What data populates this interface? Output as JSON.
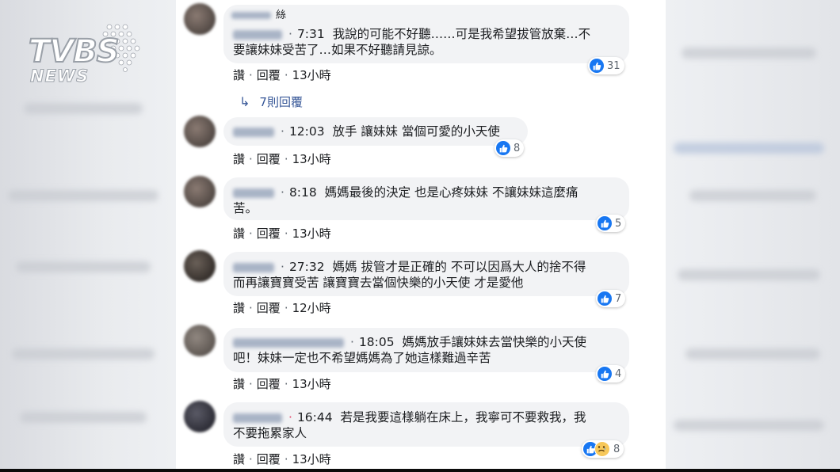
{
  "watermark": {
    "brand": "TVBS",
    "sub": "NEWS"
  },
  "comments": [
    {
      "name_suffix": "絲",
      "time": "7:31",
      "text": "我說的可能不好聽……可是我希望拔管放棄…不",
      "text2": "要讓妹妹受苦了…如果不好聽請見諒。",
      "reactions": "31",
      "like": "讚",
      "reply": "回覆",
      "age": "13小時",
      "replies_label": "7則回覆"
    },
    {
      "time": "12:03",
      "text": "放手 讓妹妹 當個可愛的小天使",
      "reactions": "8",
      "like": "讚",
      "reply": "回覆",
      "age": "13小時"
    },
    {
      "time": "8:18",
      "text": "媽媽最後的決定 也是心疼妹妹 不讓妹妹這麼痛",
      "text2": "苦。",
      "reactions": "5",
      "like": "讚",
      "reply": "回覆",
      "age": "13小時"
    },
    {
      "time": "27:32",
      "text": "媽媽 拔管才是正確的 不可以因爲大人的捨不得",
      "text2": "而再讓寶寶受苦 讓寶寶去當個快樂的小天使 才是愛他",
      "reactions": "7",
      "like": "讚",
      "reply": "回覆",
      "age": "12小時"
    },
    {
      "time": "18:05",
      "text": "媽媽放手讓妹妹去當快樂的小天使",
      "text2": "吧！妹妹一定也不希望媽媽為了她這樣難過辛苦",
      "reactions": "4",
      "like": "讚",
      "reply": "回覆",
      "age": "13小時"
    },
    {
      "time": "16:44",
      "text": "若是我要這樣躺在床上，我寧可不要救我，我",
      "text2": "不要拖累家人",
      "reactions": "8",
      "like": "讚",
      "reply": "回覆",
      "age": "13小時"
    }
  ],
  "colors": {
    "like_blue": "#1877f2",
    "bubble": "#f2f3f5",
    "link": "#385898"
  }
}
